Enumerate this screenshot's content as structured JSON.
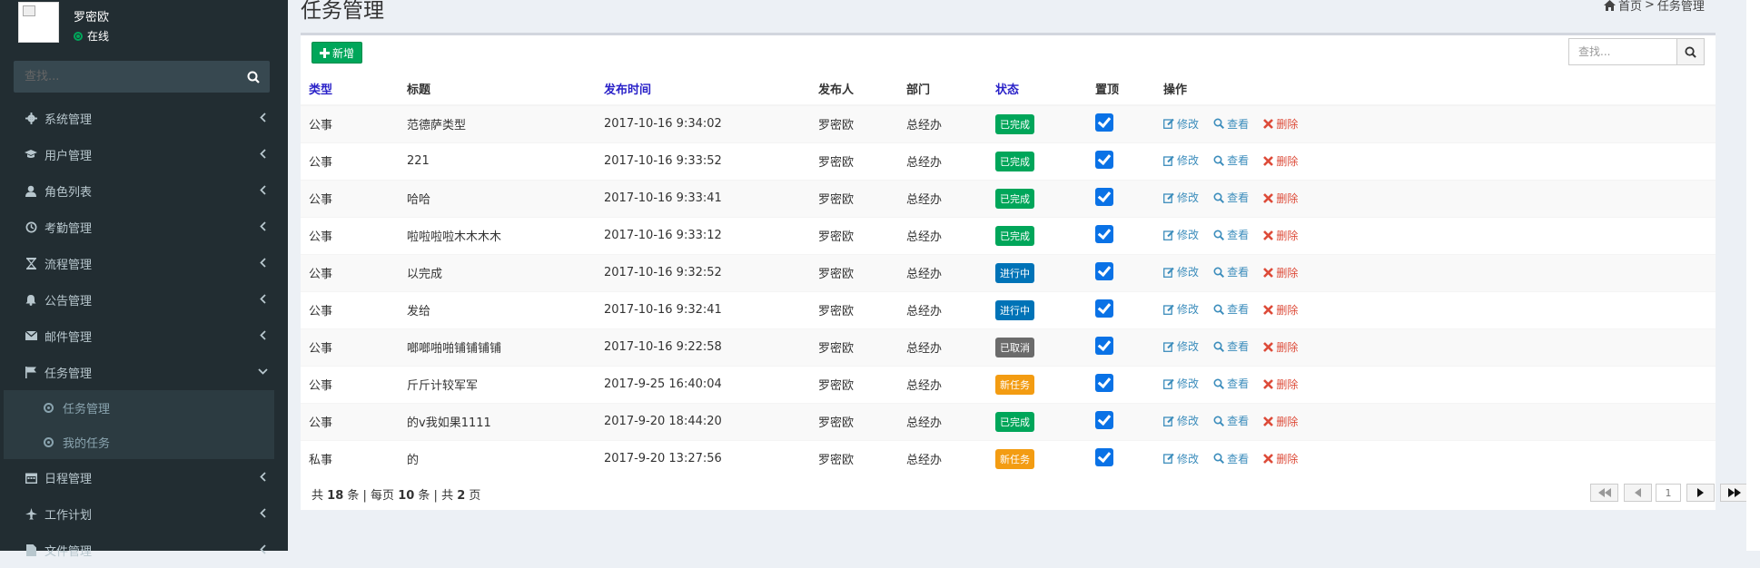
{
  "user": {
    "name": "罗密欧",
    "status": "在线"
  },
  "sidebar": {
    "search_placeholder": "查找...",
    "items": [
      {
        "label": "系统管理",
        "icon": "gear-icon"
      },
      {
        "label": "用户管理",
        "icon": "graduation-cap-icon"
      },
      {
        "label": "角色列表",
        "icon": "user-icon"
      },
      {
        "label": "考勤管理",
        "icon": "clock-icon"
      },
      {
        "label": "流程管理",
        "icon": "hourglass-icon"
      },
      {
        "label": "公告管理",
        "icon": "bell-icon"
      },
      {
        "label": "邮件管理",
        "icon": "envelope-icon"
      },
      {
        "label": "任务管理",
        "icon": "flag-icon"
      },
      {
        "label": "日程管理",
        "icon": "calendar-icon"
      },
      {
        "label": "工作计划",
        "icon": "plane-icon"
      },
      {
        "label": "文件管理",
        "icon": "file-icon"
      }
    ],
    "submenu": [
      {
        "label": "任务管理"
      },
      {
        "label": "我的任务"
      }
    ]
  },
  "header": {
    "title": "任务管理",
    "breadcrumb_home": "首页",
    "breadcrumb_sep": ">",
    "breadcrumb_current": "任务管理"
  },
  "toolbar": {
    "add_label": "新增",
    "search_placeholder": "查找..."
  },
  "table": {
    "headers": [
      "类型",
      "标题",
      "发布时间",
      "发布人",
      "部门",
      "状态",
      "置顶",
      "操作"
    ],
    "rows": [
      {
        "type": "公事",
        "title": "范德萨类型",
        "time": "2017-10-16 9:34:02",
        "publisher": "罗密欧",
        "dept": "总经办",
        "status": "已完成"
      },
      {
        "type": "公事",
        "title": "221",
        "time": "2017-10-16 9:33:52",
        "publisher": "罗密欧",
        "dept": "总经办",
        "status": "已完成"
      },
      {
        "type": "公事",
        "title": "哈哈",
        "time": "2017-10-16 9:33:41",
        "publisher": "罗密欧",
        "dept": "总经办",
        "status": "已完成"
      },
      {
        "type": "公事",
        "title": "啦啦啦啦木木木木",
        "time": "2017-10-16 9:33:12",
        "publisher": "罗密欧",
        "dept": "总经办",
        "status": "已完成"
      },
      {
        "type": "公事",
        "title": "以完成",
        "time": "2017-10-16 9:32:52",
        "publisher": "罗密欧",
        "dept": "总经办",
        "status": "进行中"
      },
      {
        "type": "公事",
        "title": "发给",
        "time": "2017-10-16 9:32:41",
        "publisher": "罗密欧",
        "dept": "总经办",
        "status": "进行中"
      },
      {
        "type": "公事",
        "title": "啷啷啪啪铺铺铺铺",
        "time": "2017-10-16 9:22:58",
        "publisher": "罗密欧",
        "dept": "总经办",
        "status": "已取消"
      },
      {
        "type": "公事",
        "title": "斤斤计较军军",
        "time": "2017-9-25 16:40:04",
        "publisher": "罗密欧",
        "dept": "总经办",
        "status": "新任务"
      },
      {
        "type": "公事",
        "title": "的v我如果1111",
        "time": "2017-9-20 18:44:20",
        "publisher": "罗密欧",
        "dept": "总经办",
        "status": "已完成"
      },
      {
        "type": "私事",
        "title": "的",
        "time": "2017-9-20 13:27:56",
        "publisher": "罗密欧",
        "dept": "总经办",
        "status": "新任务"
      }
    ],
    "actions": {
      "edit": "修改",
      "view": "查看",
      "delete": "删除"
    }
  },
  "status_colors": {
    "已完成": "#00a65a",
    "进行中": "#0073b7",
    "已取消": "#6b6b6b",
    "新任务": "#f39c12"
  },
  "footer": {
    "prefix": "共",
    "total": "18",
    "unit1": "条 | 每页",
    "per_page": "10",
    "unit2": "条 | 共",
    "pages": "2",
    "unit3": "页"
  },
  "pager": {
    "current_page": "1"
  }
}
